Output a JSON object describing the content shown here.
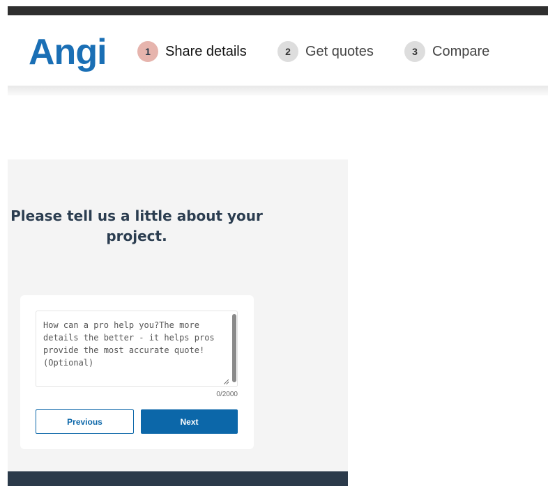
{
  "brand": {
    "logo_text": "Angi",
    "logo_color": "#1a6fb5"
  },
  "progress": {
    "steps": [
      {
        "number": "1",
        "label": "Share details",
        "active": true
      },
      {
        "number": "2",
        "label": "Get quotes",
        "active": false
      },
      {
        "number": "3",
        "label": "Compare",
        "active": false
      }
    ]
  },
  "form": {
    "heading": "Please tell us a little about your project.",
    "details": {
      "value": "",
      "placeholder": "How can a pro help you?The more details the better - it helps pros provide the most accurate quote! (Optional)",
      "char_count": "0/2000"
    },
    "previous_label": "Previous",
    "next_label": "Next"
  },
  "colors": {
    "accent": "#0c67a9",
    "active_step": "#e6b4ad",
    "heading": "#2b3d50",
    "footer": "#2b3a4a"
  }
}
